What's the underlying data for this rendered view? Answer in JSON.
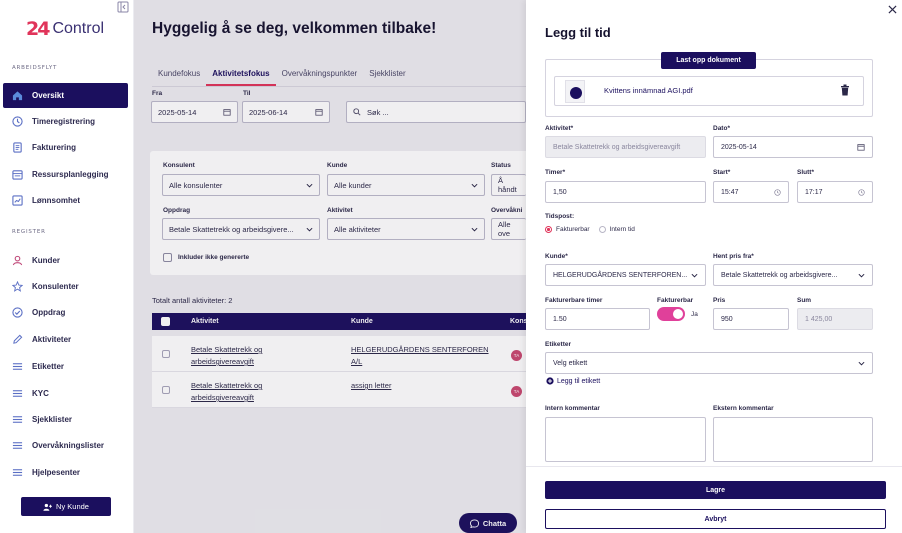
{
  "brand": {
    "mark": "24",
    "name": "Control"
  },
  "sidebar": {
    "section_workflow": "ARBEIDSFLYT",
    "section_register": "REGISTER",
    "workflow_items": [
      {
        "label": "Oversikt",
        "icon": "home-icon"
      },
      {
        "label": "Timeregistrering",
        "icon": "clock-icon"
      },
      {
        "label": "Fakturering",
        "icon": "invoice-icon"
      },
      {
        "label": "Ressursplanlegging",
        "icon": "planning-icon"
      },
      {
        "label": "Lønnsomhet",
        "icon": "chart-icon"
      }
    ],
    "register_items": [
      {
        "label": "Kunder",
        "icon": "user-icon"
      },
      {
        "label": "Konsulenter",
        "icon": "star-icon"
      },
      {
        "label": "Oppdrag",
        "icon": "badge-check-icon"
      },
      {
        "label": "Aktiviteter",
        "icon": "pencil-icon"
      },
      {
        "label": "Etiketter",
        "icon": "list-icon"
      },
      {
        "label": "KYC",
        "icon": "list-icon"
      },
      {
        "label": "Sjekklister",
        "icon": "list-icon"
      },
      {
        "label": "Overvåkningslister",
        "icon": "list-icon"
      },
      {
        "label": "Hjelpesenter",
        "icon": "list-icon"
      }
    ],
    "new_customer": "Ny Kunde"
  },
  "main": {
    "greeting": "Hyggelig å se deg, velkommen tilbake!",
    "tabs": [
      "Kundefokus",
      "Aktivitetsfokus",
      "Overvåkningspunkter",
      "Sjekklister"
    ],
    "from_label": "Fra",
    "from_value": "2025-05-14",
    "to_label": "Til",
    "to_value": "2025-06-14",
    "search_placeholder": "Søk ...",
    "filters": {
      "consultant_label": "Konsulent",
      "consultant_value": "Alle konsulenter",
      "customer_label": "Kunde",
      "customer_value": "Alle kunder",
      "status_label": "Status",
      "status_value": "Å håndt",
      "assignment_label": "Oppdrag",
      "assignment_value": "Betale Skattetrekk og arbeidsgivere...",
      "activity_label": "Aktivitet",
      "activity_value": "Alle aktiviteter",
      "monitor_label": "Overvåkni",
      "monitor_value": "Alle ove",
      "include_label": "Inkluder ikke genererte"
    },
    "total": "Totalt antall aktiviteter: 2",
    "table": {
      "headers": [
        "Aktivitet",
        "Kunde",
        "Kons"
      ],
      "rows": [
        {
          "activity_1": "Betale Skattetrekk og",
          "activity_2": "arbeidsgivereavgift",
          "customer_1": "HELGERUDGÅRDENS SENTERFOREN",
          "customer_2": "A/L",
          "badge": "TA"
        },
        {
          "activity_1": "Betale Skattetrekk og",
          "activity_2": "arbeidsgivereavgift",
          "customer_1": "assign letter",
          "customer_2": "",
          "badge": "TA"
        }
      ]
    },
    "chat": "Chatta"
  },
  "drawer": {
    "title": "Legg til tid",
    "upload": "Last opp dokument",
    "file_name": "Kvittens innämnad AGI.pdf",
    "activity_label": "Aktivitet*",
    "activity_value": "Betale Skattetrekk og arbeidsgivereavgift",
    "date_label": "Dato*",
    "date_value": "2025-05-14",
    "hours_label": "Timer*",
    "hours_value": "1,50",
    "start_label": "Start*",
    "start_value": "15:47",
    "end_label": "Slutt*",
    "end_value": "17:17",
    "timepost_label": "Tidspost:",
    "billable_option": "Fakturerbar",
    "internal_option": "Intern tid",
    "customer_label": "Kunde*",
    "customer_value": "HELGERUDGÅRDENS SENTERFOREN...",
    "price_from_label": "Hent pris fra*",
    "price_from_value": "Betale Skattetrekk og arbeidsgivere...",
    "billable_hours_label": "Fakturerbare timer",
    "billable_hours_value": "1.50",
    "billable_label": "Fakturerbar",
    "billable_toggle_text": "Ja",
    "price_label": "Pris",
    "price_value": "950",
    "sum_label": "Sum",
    "sum_value": "1 425,00",
    "tag_label": "Etiketter",
    "tag_placeholder": "Velg etikett",
    "add_tag": "Legg til etikett",
    "internal_comment": "Intern kommentar",
    "external_comment": "Ekstern kommentar",
    "save": "Lagre",
    "cancel": "Avbryt"
  },
  "colors": {
    "primary": "#1b0f5e",
    "accent": "#e0345a",
    "toggle": "#e0409a"
  }
}
